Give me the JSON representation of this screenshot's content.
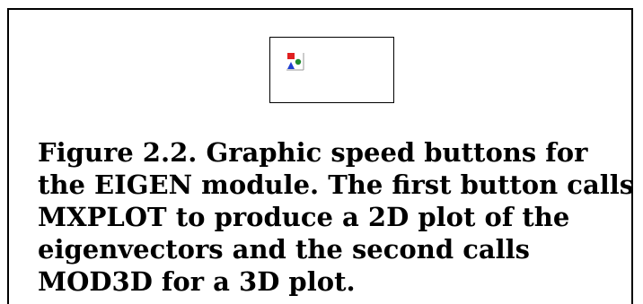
{
  "figure": {
    "caption": "Figure 2.2. Graphic speed buttons for the EIGEN module.  The first button calls MXPLOT to produce a 2D plot of the eigenvectors and the second calls MOD3D for a 3D plot.",
    "button_icon": "shapes-plot-icon",
    "icon_colors": {
      "square": "#e02020",
      "circle": "#1e8a2e",
      "triangle": "#1f3fd0"
    }
  }
}
